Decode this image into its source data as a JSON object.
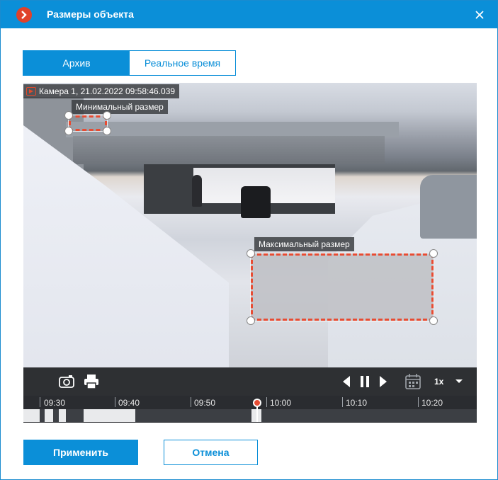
{
  "window": {
    "title": "Размеры объекта"
  },
  "tabs": [
    {
      "label": "Архив",
      "active": true
    },
    {
      "label": "Реальное время",
      "active": false
    }
  ],
  "video": {
    "camera_label": "Камера 1, 21.02.2022 09:58:46.039",
    "min_size_label": "Минимальный размер",
    "max_size_label": "Максимальный размер"
  },
  "controls": {
    "speed": "1x"
  },
  "timeline": {
    "ticks": [
      "09:30",
      "09:40",
      "09:50",
      "10:00",
      "10:10",
      "10:20"
    ]
  },
  "buttons": {
    "apply": "Применить",
    "cancel": "Отмена"
  },
  "colors": {
    "accent": "#0b8fd8",
    "selection": "#e74c33",
    "logo": "#e0412a"
  }
}
